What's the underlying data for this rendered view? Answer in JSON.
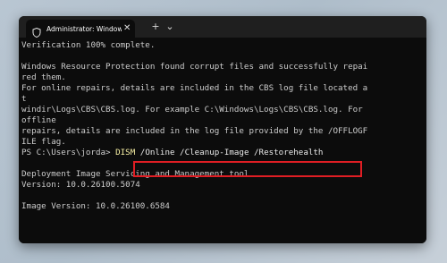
{
  "window": {
    "tab_title": "Administrator: Windows Pow",
    "tab_icon": "shield-icon",
    "close_symbol": "✕",
    "new_tab_symbol": "+",
    "dropdown_symbol": "⌄"
  },
  "terminal": {
    "lines": [
      "Verification 100% complete.",
      "",
      "Windows Resource Protection found corrupt files and successfully repai",
      "red them.",
      "For online repairs, details are included in the CBS log file located a",
      "t",
      "windir\\Logs\\CBS\\CBS.log. For example C:\\Windows\\Logs\\CBS\\CBS.log. For",
      "offline",
      "repairs, details are included in the log file provided by the /OFFLOGF",
      "ILE flag.",
      "",
      "",
      "Deployment Image Servicing and Management tool",
      "Version: 10.0.26100.5074",
      "",
      "Image Version: 10.0.26100.6584"
    ],
    "prompt": {
      "path": "PS C:\\Users\\jorda> ",
      "command": "DISM",
      "args": " /Online /Cleanup-Image /Restorehealth"
    }
  },
  "colors": {
    "terminal_bg": "#0c0c0c",
    "text": "#cccccc",
    "command_highlight": "#f9f1a5",
    "annotation_box": "#e01e24"
  }
}
